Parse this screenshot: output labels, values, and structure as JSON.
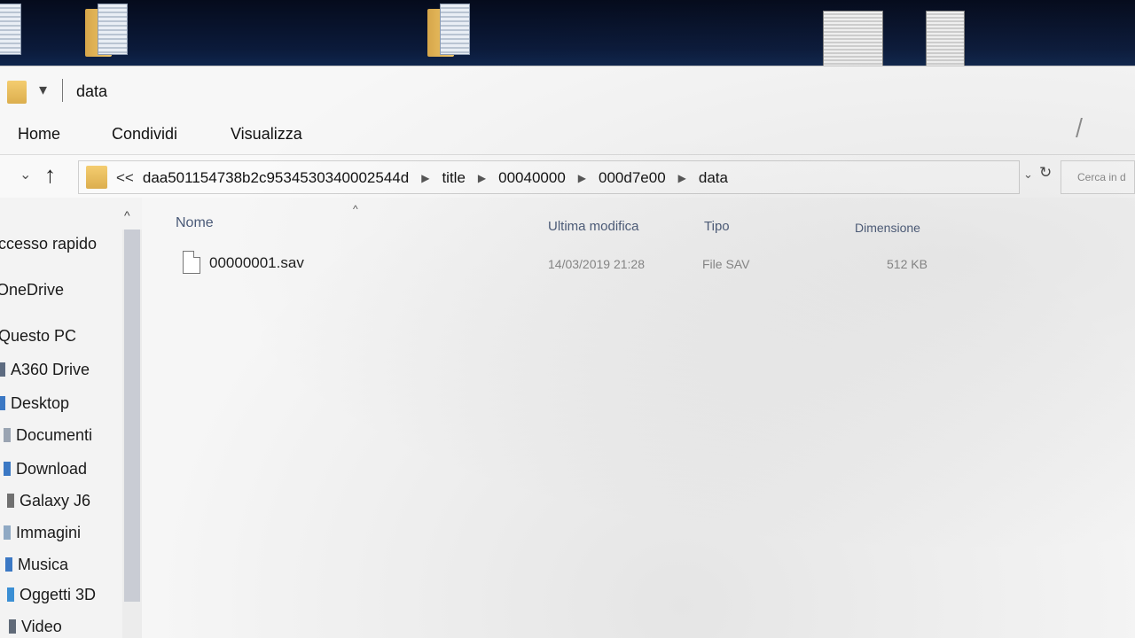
{
  "window": {
    "title": "data"
  },
  "ribbon": {
    "tabs": [
      "Home",
      "Condividi",
      "Visualizza"
    ]
  },
  "addressbar": {
    "prefix": "<<",
    "crumbs": [
      "daa501154738b2c9534530340002544d",
      "title",
      "00040000",
      "000d7e00",
      "data"
    ],
    "search_placeholder": "Cerca in d"
  },
  "navpane": {
    "items": [
      {
        "label": "ccesso rapido",
        "icon": "star-icon"
      },
      {
        "label": "OneDrive",
        "icon": "cloud-icon"
      },
      {
        "label": "Questo PC",
        "icon": "computer-icon"
      },
      {
        "label": "A360 Drive",
        "icon": "drive-icon"
      },
      {
        "label": "Desktop",
        "icon": "desktop-icon"
      },
      {
        "label": "Documenti",
        "icon": "documents-icon"
      },
      {
        "label": "Download",
        "icon": "download-icon"
      },
      {
        "label": "Galaxy J6",
        "icon": "phone-icon"
      },
      {
        "label": "Immagini",
        "icon": "pictures-icon"
      },
      {
        "label": "Musica",
        "icon": "music-icon"
      },
      {
        "label": "Oggetti 3D",
        "icon": "cube-icon"
      },
      {
        "label": "Video",
        "icon": "video-icon"
      }
    ]
  },
  "columns": {
    "name": "Nome",
    "modified": "Ultima modifica",
    "type": "Tipo",
    "size": "Dimensione"
  },
  "files": [
    {
      "name": "00000001.sav",
      "modified": "14/03/2019 21:28",
      "type": "File SAV",
      "size": "512 KB"
    }
  ],
  "colors": {
    "folder": "#dcae4e",
    "column_header": "#4a5a78",
    "desktop_bg": "#0b1a3a"
  }
}
